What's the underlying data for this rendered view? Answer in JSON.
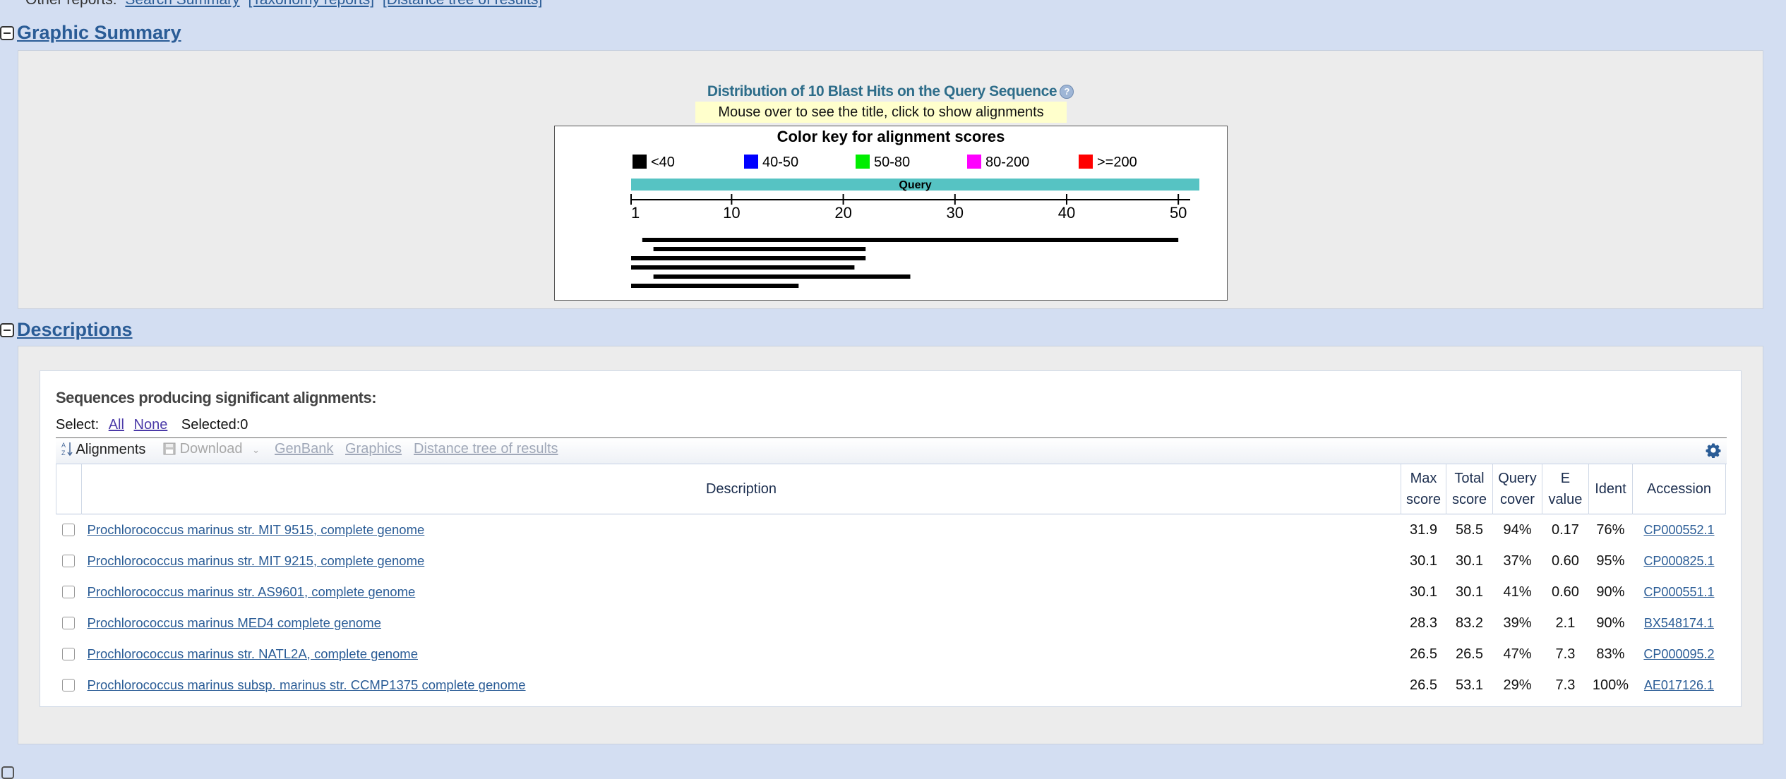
{
  "top_nav": {
    "label": "Other reports:",
    "links": [
      "Search Summary",
      "[Taxonomy reports]",
      "[Distance tree of results]"
    ]
  },
  "graphic_summary": {
    "title": "Graphic Summary",
    "dist_title": "Distribution of 10 Blast Hits on the Query Sequence",
    "mouse_note": "Mouse over to see the title, click to show alignments",
    "color_key_title": "Color key for alignment scores",
    "color_key": [
      {
        "label": "<40",
        "color": "#000000"
      },
      {
        "label": "40-50",
        "color": "#0000ff"
      },
      {
        "label": "50-80",
        "color": "#00ee00"
      },
      {
        "label": "80-200",
        "color": "#ff00ff"
      },
      {
        "label": ">=200",
        "color": "#ff0000"
      }
    ],
    "query_label": "Query",
    "query_color": "#56c3c3",
    "query_length": 51,
    "ticks": [
      1,
      10,
      20,
      30,
      40,
      50
    ],
    "hits": [
      {
        "start": 2,
        "end": 50
      },
      {
        "start": 3,
        "end": 22
      },
      {
        "start": 1,
        "end": 22
      },
      {
        "start": 1,
        "end": 21
      },
      {
        "start": 3,
        "end": 26
      },
      {
        "start": 1,
        "end": 16
      }
    ]
  },
  "descriptions": {
    "title": "Descriptions",
    "heading": "Sequences producing significant alignments:",
    "select_label": "Select:",
    "select_all": "All",
    "select_none": "None",
    "selected_text": "Selected:0",
    "toolbar": {
      "alignments": "Alignments",
      "download": "Download",
      "genbank": "GenBank",
      "graphics": "Graphics",
      "distance_tree": "Distance tree of results"
    },
    "columns": {
      "description": "Description",
      "max_score": [
        "Max",
        "score"
      ],
      "total_score": [
        "Total",
        "score"
      ],
      "query_cover": [
        "Query",
        "cover"
      ],
      "e_value": [
        "E",
        "value"
      ],
      "ident": "Ident",
      "accession": "Accession"
    },
    "rows": [
      {
        "description": "Prochlorococcus marinus str. MIT 9515, complete genome",
        "max_score": "31.9",
        "total_score": "58.5",
        "query_cover": "94%",
        "e_value": "0.17",
        "ident": "76%",
        "accession": "CP000552.1"
      },
      {
        "description": "Prochlorococcus marinus str. MIT 9215, complete genome",
        "max_score": "30.1",
        "total_score": "30.1",
        "query_cover": "37%",
        "e_value": "0.60",
        "ident": "95%",
        "accession": "CP000825.1"
      },
      {
        "description": "Prochlorococcus marinus str. AS9601, complete genome",
        "max_score": "30.1",
        "total_score": "30.1",
        "query_cover": "41%",
        "e_value": "0.60",
        "ident": "90%",
        "accession": "CP000551.1"
      },
      {
        "description": "Prochlorococcus marinus MED4 complete genome",
        "max_score": "28.3",
        "total_score": "83.2",
        "query_cover": "39%",
        "e_value": "2.1",
        "ident": "90%",
        "accession": "BX548174.1"
      },
      {
        "description": "Prochlorococcus marinus str. NATL2A, complete genome",
        "max_score": "26.5",
        "total_score": "26.5",
        "query_cover": "47%",
        "e_value": "7.3",
        "ident": "83%",
        "accession": "CP000095.2"
      },
      {
        "description": "Prochlorococcus marinus subsp. marinus str. CCMP1375 complete genome",
        "max_score": "26.5",
        "total_score": "53.1",
        "query_cover": "29%",
        "e_value": "7.3",
        "ident": "100%",
        "accession": "AE017126.1"
      }
    ]
  }
}
